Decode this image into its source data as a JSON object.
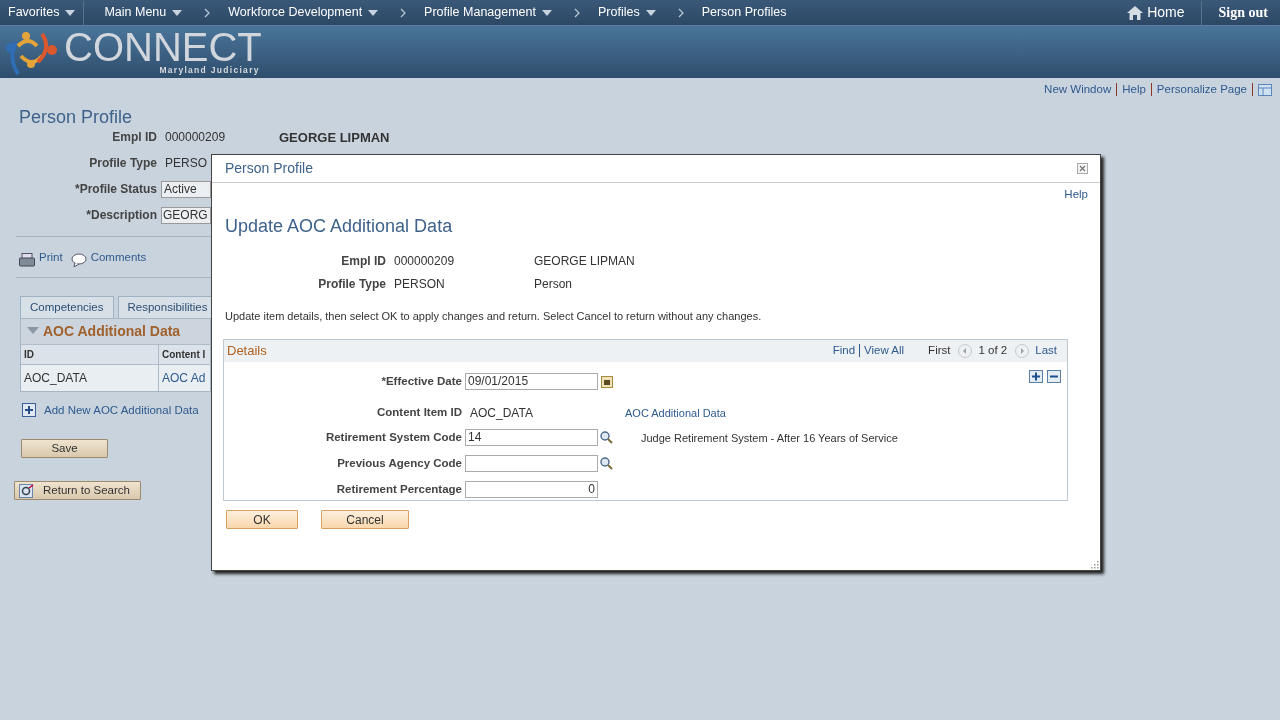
{
  "nav": {
    "items": [
      {
        "label": "Favorites",
        "dropdown": true
      },
      {
        "label": "Main Menu",
        "dropdown": true
      },
      {
        "label": "Workforce Development",
        "dropdown": true
      },
      {
        "label": "Profile Management",
        "dropdown": true
      },
      {
        "label": "Profiles",
        "dropdown": true
      },
      {
        "label": "Person Profiles",
        "dropdown": false
      }
    ],
    "home": "Home",
    "sign_out": "Sign out"
  },
  "brand": {
    "name": "CONNECT",
    "subtitle": "Maryland Judiciary"
  },
  "page_links": [
    "New Window",
    "Help",
    "Personalize Page"
  ],
  "page": {
    "title": "Person Profile",
    "empl": {
      "label": "Empl ID",
      "value": "000000209",
      "name": "GEORGE LIPMAN"
    },
    "fields": [
      {
        "label": "Profile Type",
        "kind": "text",
        "value": "PERSO"
      },
      {
        "label": "*Profile Status",
        "kind": "select",
        "value": "Active"
      },
      {
        "label": "*Description",
        "kind": "input",
        "value": "GEORG"
      }
    ],
    "actions": [
      "Print",
      "Comments"
    ],
    "tabs": [
      {
        "label": "Competencies",
        "selected": false
      },
      {
        "label": "Responsibilities",
        "selected": false
      }
    ],
    "grid": {
      "title": "AOC Additional Data",
      "expanded": true,
      "columns": [
        "ID",
        "Content I"
      ],
      "rows": [
        [
          "AOC_DATA",
          "AOC Ad"
        ]
      ]
    },
    "add_link": "Add New AOC Additional Data",
    "save": "Save",
    "return": "Return to Search"
  },
  "modal": {
    "title": "Person Profile",
    "help": "Help",
    "heading": "Update AOC Additional Data",
    "header": [
      {
        "label": "Empl ID",
        "value": "000000209",
        "desc": "GEORGE LIPMAN"
      },
      {
        "label": "Profile Type",
        "value": "PERSON",
        "desc": "Person"
      }
    ],
    "instructions": "Update item details, then select OK to apply changes and return. Select Cancel to return without any changes.",
    "details": {
      "title": "Details",
      "find": "Find",
      "view_all": "View All",
      "first": "First",
      "count": "1 of 2",
      "last": "Last",
      "fields": [
        {
          "label": "*Effective Date",
          "kind": "date",
          "value": "09/01/2015"
        },
        {
          "label": "Content Item ID",
          "kind": "text",
          "value": "AOC_DATA",
          "desc": "AOC Additional Data",
          "desc_link": true
        },
        {
          "label": "Retirement System Code",
          "kind": "lookup",
          "value": "14",
          "desc": "Judge Retirement System - After 16 Years of Service",
          "desc_link": false
        },
        {
          "label": "Previous Agency Code",
          "kind": "lookup"
        },
        {
          "label": "Retirement Percentage",
          "kind": "number",
          "value": "0"
        }
      ]
    },
    "buttons": [
      "OK",
      "Cancel"
    ]
  }
}
